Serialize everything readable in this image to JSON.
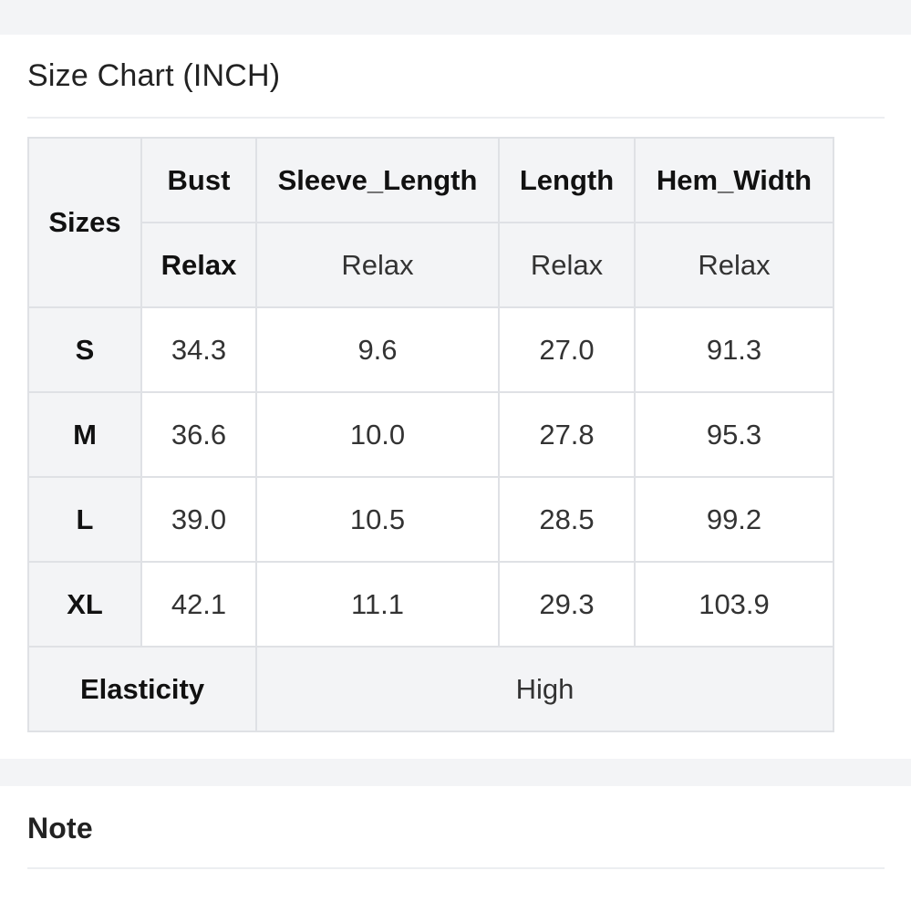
{
  "size_chart": {
    "title": "Size Chart (INCH)",
    "header": {
      "sizes_label": "Sizes",
      "columns": [
        "Bust",
        "Sleeve_Length",
        "Length",
        "Hem_Width"
      ],
      "fit": [
        "Relax",
        "Relax",
        "Relax",
        "Relax"
      ]
    },
    "rows": [
      {
        "size": "S",
        "values": [
          "34.3",
          "9.6",
          "27.0",
          "91.3"
        ]
      },
      {
        "size": "M",
        "values": [
          "36.6",
          "10.0",
          "27.8",
          "95.3"
        ]
      },
      {
        "size": "L",
        "values": [
          "39.0",
          "10.5",
          "28.5",
          "99.2"
        ]
      },
      {
        "size": "XL",
        "values": [
          "42.1",
          "11.1",
          "29.3",
          "103.9"
        ]
      }
    ],
    "elasticity": {
      "label": "Elasticity",
      "value": "High"
    }
  },
  "note": {
    "title": "Note"
  }
}
